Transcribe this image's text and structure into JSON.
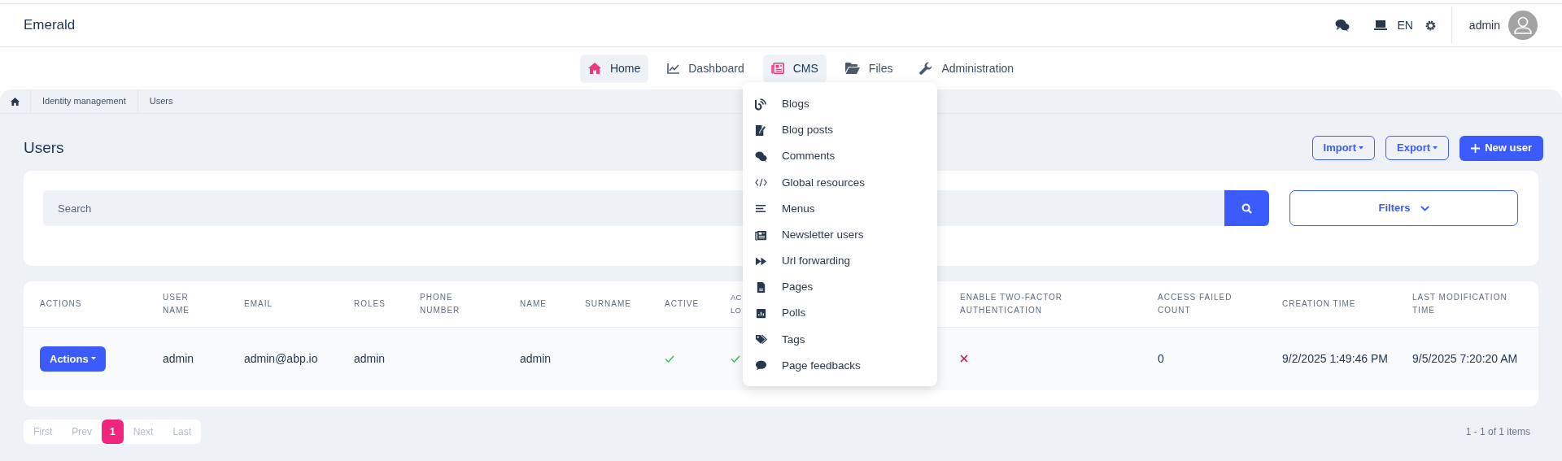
{
  "brand": "Emerald",
  "header": {
    "language": "EN",
    "user": "admin"
  },
  "nav": [
    {
      "label": "Home",
      "selected": true
    },
    {
      "label": "Dashboard",
      "selected": false
    },
    {
      "label": "CMS",
      "selected": true
    },
    {
      "label": "Files",
      "selected": false
    },
    {
      "label": "Administration",
      "selected": false
    }
  ],
  "cms_menu": [
    "Blogs",
    "Blog posts",
    "Comments",
    "Global resources",
    "Menus",
    "Newsletter users",
    "Url forwarding",
    "Pages",
    "Polls",
    "Tags",
    "Page feedbacks"
  ],
  "breadcrumb": [
    "Identity management",
    "Users"
  ],
  "page_title": "Users",
  "toolbar": {
    "import": "Import",
    "export": "Export",
    "new": "New user"
  },
  "search": {
    "placeholder": "Search",
    "filters": "Filters"
  },
  "table": {
    "columns": [
      "ACTIONS",
      "USER NAME",
      "EMAIL",
      "ROLES",
      "PHONE NUMBER",
      "NAME",
      "SURNAME",
      "ACTIVE",
      "AC LO",
      "ENABLE TWO-FACTOR AUTHENTICATION",
      "ACCESS FAILED COUNT",
      "CREATION TIME",
      "LAST MODIFICATION TIME"
    ],
    "rows": [
      {
        "cells": [
          {
            "kind": "button",
            "text": "Actions"
          },
          {
            "kind": "text",
            "text": "admin"
          },
          {
            "kind": "text",
            "text": "admin@abp.io"
          },
          {
            "kind": "text",
            "text": "admin"
          },
          {
            "kind": "empty"
          },
          {
            "kind": "text",
            "text": "admin"
          },
          {
            "kind": "empty"
          },
          {
            "kind": "bool",
            "checked": true
          },
          {
            "kind": "bool",
            "checked": true
          },
          {
            "kind": "bool",
            "checked": false
          },
          {
            "kind": "text",
            "text": "0"
          },
          {
            "kind": "text",
            "text": "9/2/2025 1:49:46 PM"
          },
          {
            "kind": "text",
            "text": "9/5/2025 7:20:20 AM"
          }
        ]
      }
    ]
  },
  "pagination": {
    "pages": [
      {
        "label": "First",
        "selected": false,
        "disabled": true
      },
      {
        "label": "Prev",
        "selected": false,
        "disabled": true
      },
      {
        "label": "1",
        "selected": true,
        "disabled": false
      },
      {
        "label": "Next",
        "selected": false,
        "disabled": true
      },
      {
        "label": "Last",
        "selected": false,
        "disabled": true
      }
    ],
    "summary": "1 - 1 of 1 items"
  }
}
